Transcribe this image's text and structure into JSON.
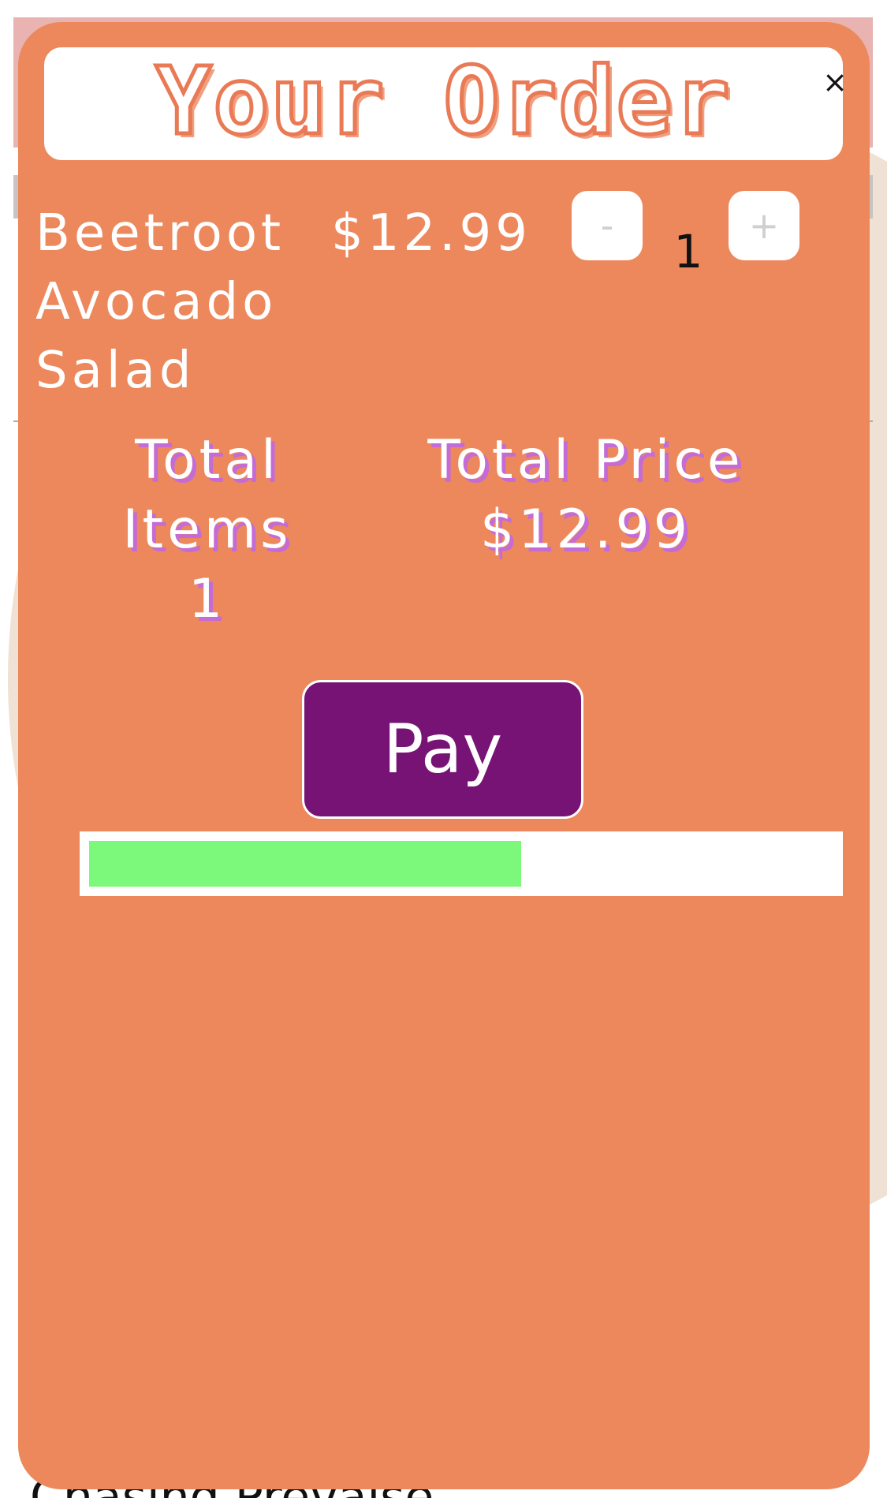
{
  "modal": {
    "title": "Your Order",
    "close_label": "×"
  },
  "order": {
    "items": [
      {
        "name": "Beetroot Avocado Salad",
        "price": "$12.99",
        "quantity": "1",
        "decrement_label": "-",
        "increment_label": "+"
      }
    ]
  },
  "summary": {
    "total_items_label": "Total Items",
    "total_items_value": "1",
    "total_price_label": "Total Price",
    "total_price_value": "$12.99"
  },
  "pay": {
    "label": "Pay"
  },
  "progress": {
    "fraction": 0.58
  },
  "background": {
    "footer_text": "Chasing Prevaise"
  },
  "colors": {
    "modal_bg": "#ec885c",
    "pay_button": "#771374",
    "progress_fill": "#7cf97a",
    "title_outline": "#e97a55"
  }
}
